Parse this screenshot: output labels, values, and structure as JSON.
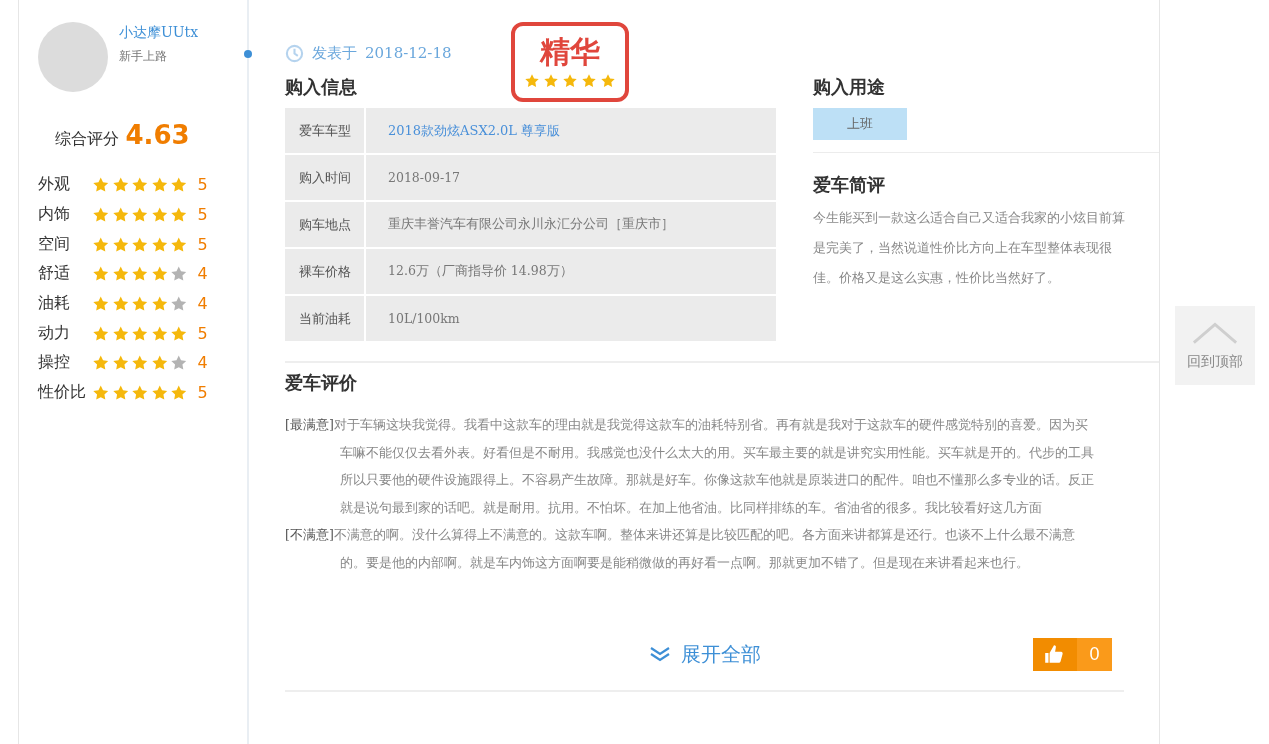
{
  "author": {
    "name": "小达摩UUtx",
    "level": "新手上路"
  },
  "overall": {
    "label": "综合评分",
    "score": "4.63"
  },
  "ratings": [
    {
      "label": "外观",
      "stars": 5,
      "score": "5"
    },
    {
      "label": "内饰",
      "stars": 5,
      "score": "5"
    },
    {
      "label": "空间",
      "stars": 5,
      "score": "5"
    },
    {
      "label": "舒适",
      "stars": 4,
      "score": "4"
    },
    {
      "label": "油耗",
      "stars": 4,
      "score": "4"
    },
    {
      "label": "动力",
      "stars": 5,
      "score": "5"
    },
    {
      "label": "操控",
      "stars": 4,
      "score": "4"
    },
    {
      "label": "性价比",
      "stars": 5,
      "score": "5"
    }
  ],
  "post": {
    "published": "发表于",
    "date": "2018-12-18",
    "badge": {
      "title": "精华",
      "stars": 5
    }
  },
  "purchase_info": {
    "title": "购入信息",
    "rows": [
      {
        "label": "爱车车型",
        "value": "2018款劲炫ASX2.0L 尊享版",
        "kind": "link"
      },
      {
        "label": "购入时间",
        "value": "2018-09-17",
        "kind": "text"
      },
      {
        "label": "购车地点",
        "value": "重庆丰誉汽车有限公司永川永汇分公司［重庆市］",
        "kind": "text"
      },
      {
        "label": "裸车价格",
        "value": "12.6万（厂商指导价 14.98万）",
        "kind": "text"
      },
      {
        "label": "当前油耗",
        "value": "10L/100km",
        "kind": "text"
      }
    ]
  },
  "purpose": {
    "title": "购入用途",
    "tags": [
      "上班"
    ]
  },
  "brief": {
    "title": "爱车简评",
    "text": "今生能买到一款这么适合自己又适合我家的小炫目前算是完美了，当然说道性价比方向上在车型整体表现很佳。价格又是这么实惠，性价比当然好了。"
  },
  "review": {
    "title": "爱车评价",
    "sections": [
      {
        "label": "[最满意]",
        "text": "对于车辆这块我觉得。我看中这款车的理由就是我觉得这款车的油耗特别省。再有就是我对于这款车的硬件感觉特别的喜爱。因为买车嘛不能仅仅去看外表。好看但是不耐用。我感觉也没什么太大的用。买车最主要的就是讲究实用性能。买车就是开的。代步的工具所以只要他的硬件设施跟得上。不容易产生故障。那就是好车。你像这款车他就是原装进口的配件。咱也不懂那么多专业的话。反正就是说句最到家的话吧。就是耐用。抗用。不怕坏。在加上他省油。比同样排练的车。省油省的很多。我比较看好这几方面"
      },
      {
        "label": "[不满意]",
        "text": "不满意的啊。没什么算得上不满意的。这款车啊。整体来讲还算是比较匹配的吧。各方面来讲都算是还行。也谈不上什么最不满意的。要是他的内部啊。就是车内饰这方面啊要是能稍微做的再好看一点啊。那就更加不错了。但是现在来讲看起来也行。"
      }
    ]
  },
  "expand": "展开全部",
  "likes": "0",
  "back_to_top": "回到顶部"
}
